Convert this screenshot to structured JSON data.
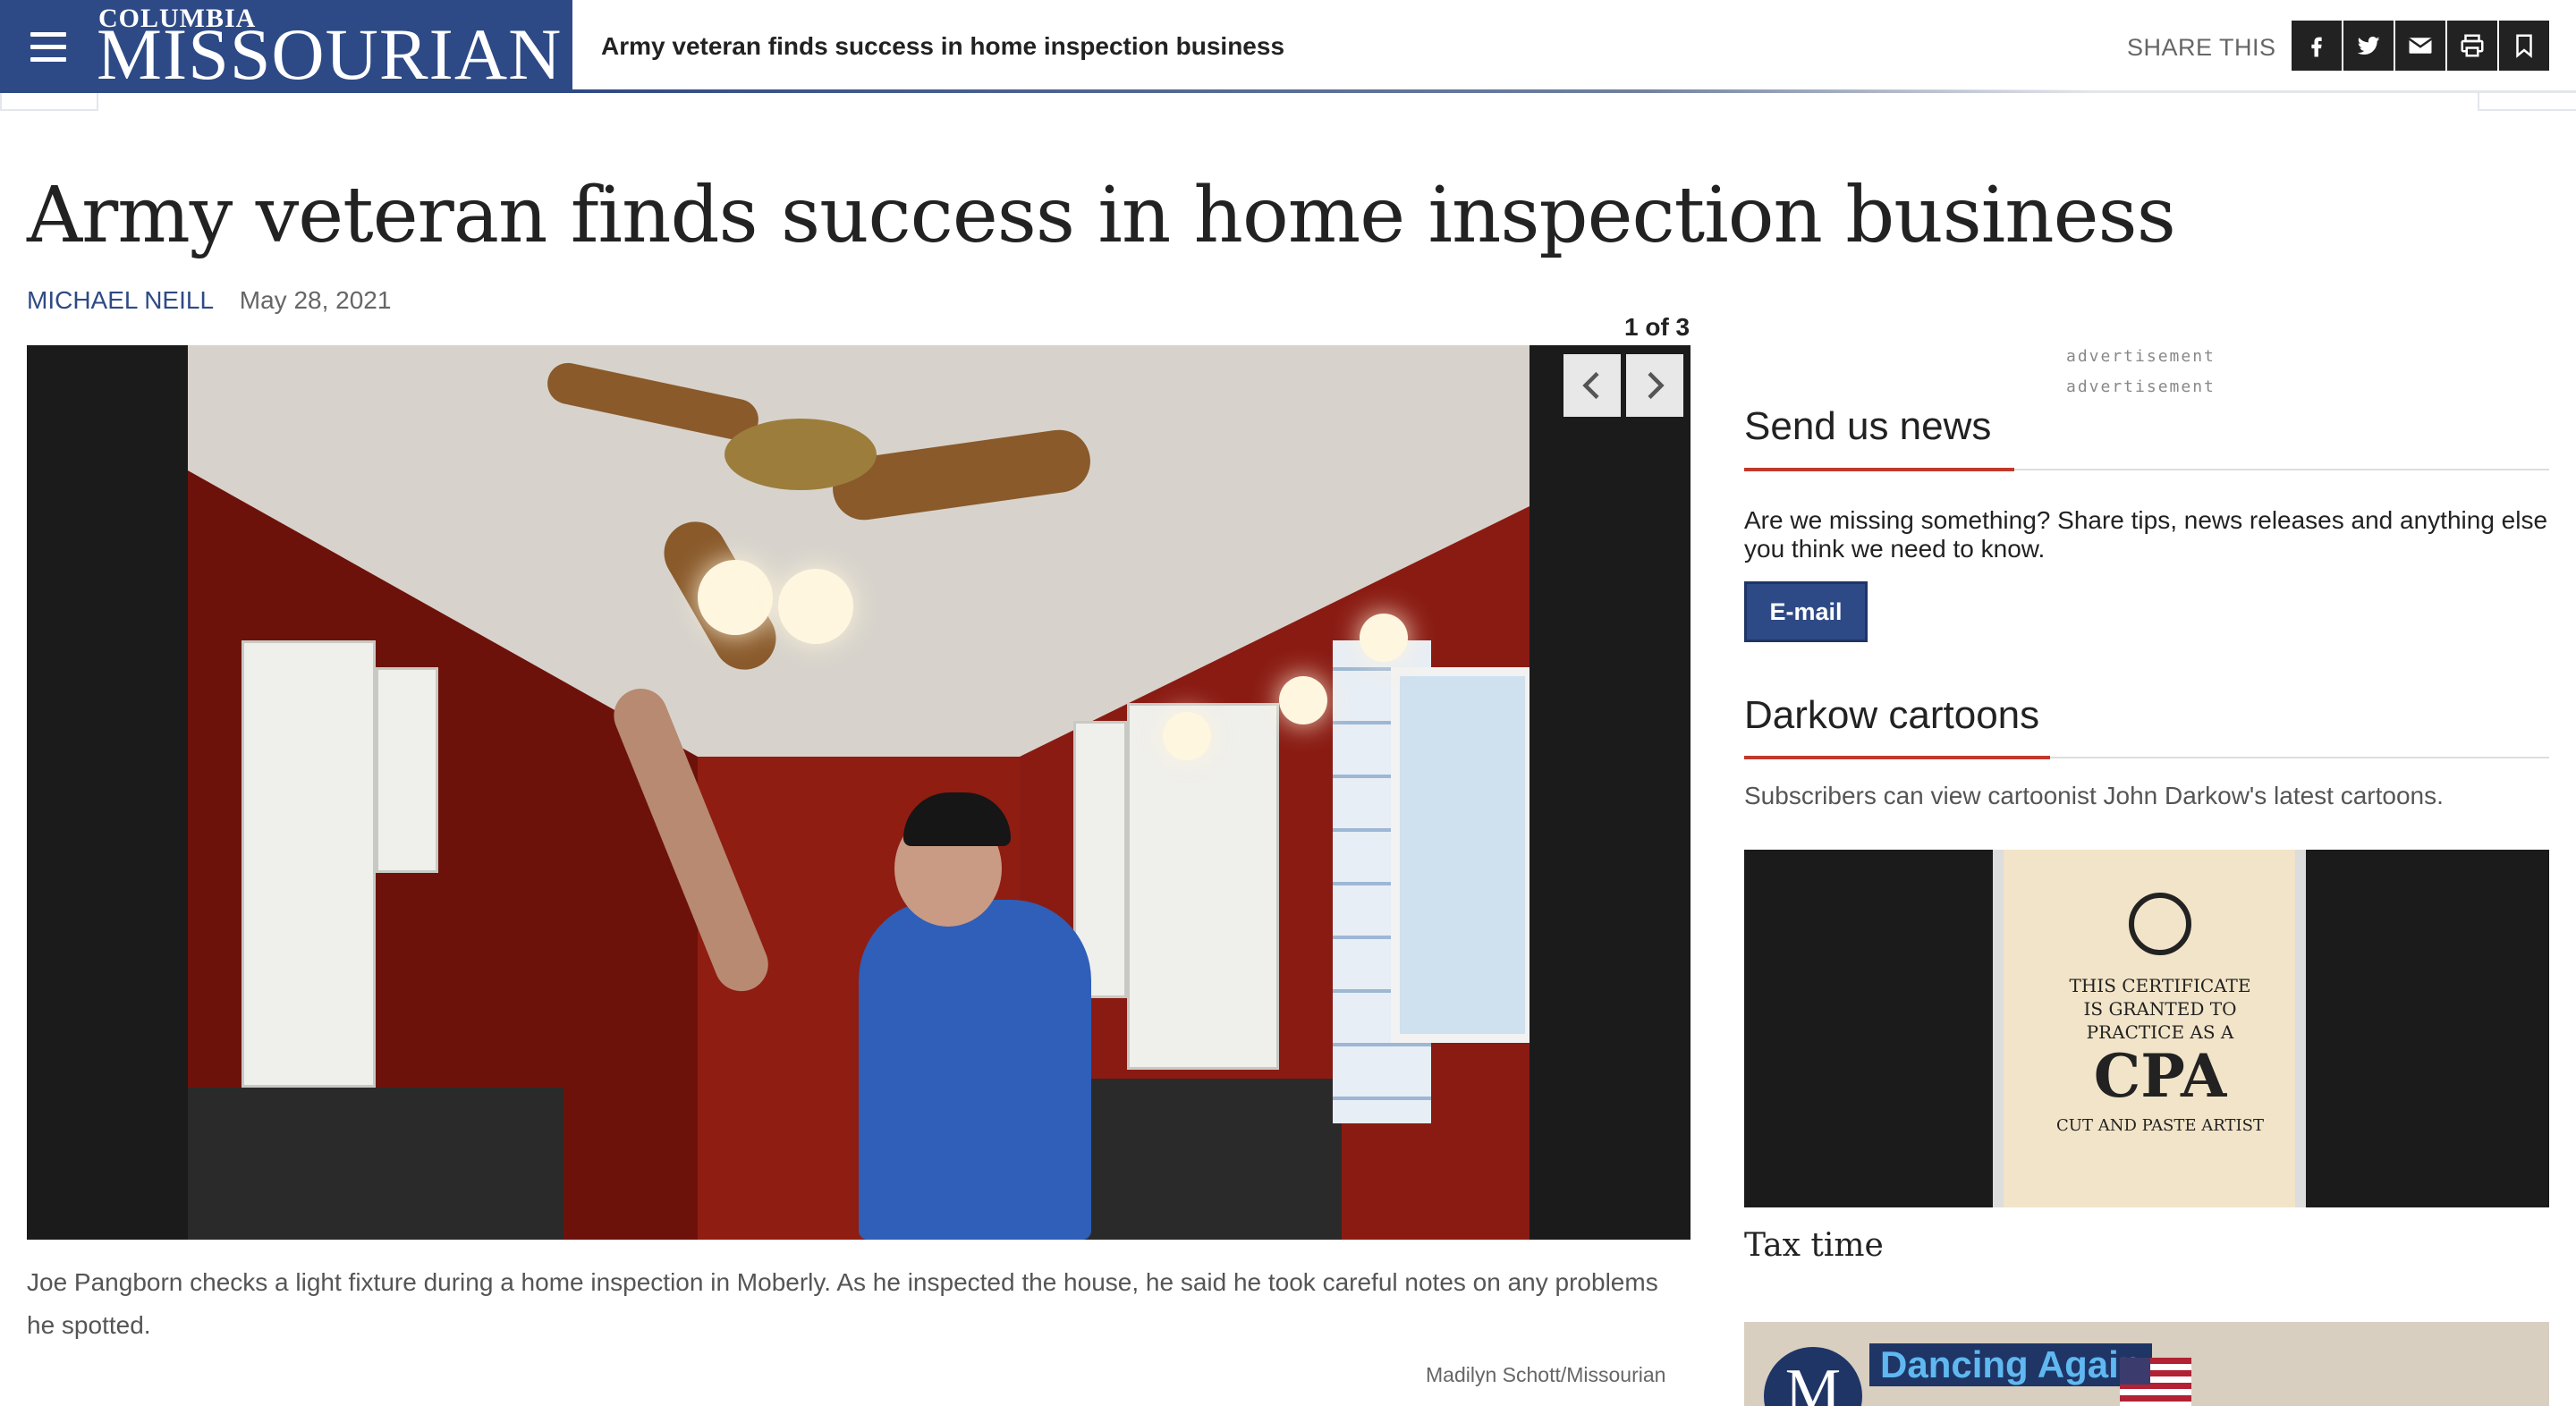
{
  "header": {
    "brand_small": "COLUMBIA",
    "brand_big": "MISSOURIAN",
    "sticky_headline": "Army veteran finds success in home inspection business",
    "share_label": "SHARE THIS",
    "share_icons": [
      "facebook-icon",
      "twitter-icon",
      "email-icon",
      "print-icon",
      "bookmark-icon"
    ],
    "brand_color": "#2e4a86"
  },
  "article": {
    "headline": "Army veteran finds success in home inspection business",
    "author": "MICHAEL NEILL",
    "date": "May 28, 2021",
    "gallery": {
      "counter": "1 of 3",
      "caption": "Joe Pangborn checks a light fixture during a home inspection in Moberly. As he inspected the house, he said he took careful notes on any problems he spotted.",
      "credit": "Madilyn Schott/Missourian"
    }
  },
  "sidebar": {
    "ad_label_1": "advertisement",
    "ad_label_2": "advertisement",
    "send_news": {
      "title": "Send us news",
      "text": "Are we missing something? Share tips, news releases and anything else you think we need to know.",
      "button": "E-mail"
    },
    "darkow": {
      "title": "Darkow cartoons",
      "text": "Subscribers can view cartoonist John Darkow's latest cartoons.",
      "cartoon_lines": [
        "THIS CERTIFICATE",
        "IS GRANTED TO",
        "PRACTICE AS A",
        "CPA",
        "CUT AND PASTE ARTIST"
      ],
      "cartoon_caption": "Tax time"
    },
    "promo": {
      "logo_letter": "M",
      "title": "Dancing Again"
    },
    "accent_color": "#c0392b"
  }
}
